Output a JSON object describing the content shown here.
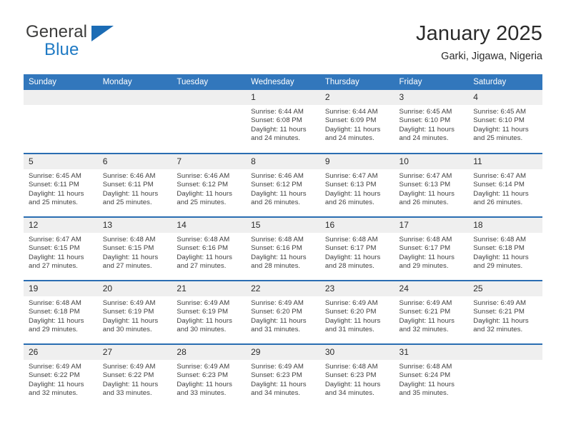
{
  "brand": {
    "name_top": "General",
    "name_bottom": "Blue",
    "color_dark": "#3c3c3b",
    "color_blue": "#1f7ac4"
  },
  "header": {
    "title": "January 2025",
    "subtitle": "Garki, Jigawa, Nigeria"
  },
  "theme": {
    "header_blue": "#3277bc",
    "row_divider_blue": "#2a6db2",
    "daynum_gray": "#efefef"
  },
  "weekday_headers": [
    "Sunday",
    "Monday",
    "Tuesday",
    "Wednesday",
    "Thursday",
    "Friday",
    "Saturday"
  ],
  "weeks": [
    [
      {
        "day": "",
        "lines": []
      },
      {
        "day": "",
        "lines": []
      },
      {
        "day": "",
        "lines": []
      },
      {
        "day": "1",
        "lines": [
          "Sunrise: 6:44 AM",
          "Sunset: 6:08 PM",
          "Daylight: 11 hours",
          "and 24 minutes."
        ]
      },
      {
        "day": "2",
        "lines": [
          "Sunrise: 6:44 AM",
          "Sunset: 6:09 PM",
          "Daylight: 11 hours",
          "and 24 minutes."
        ]
      },
      {
        "day": "3",
        "lines": [
          "Sunrise: 6:45 AM",
          "Sunset: 6:10 PM",
          "Daylight: 11 hours",
          "and 24 minutes."
        ]
      },
      {
        "day": "4",
        "lines": [
          "Sunrise: 6:45 AM",
          "Sunset: 6:10 PM",
          "Daylight: 11 hours",
          "and 25 minutes."
        ]
      }
    ],
    [
      {
        "day": "5",
        "lines": [
          "Sunrise: 6:45 AM",
          "Sunset: 6:11 PM",
          "Daylight: 11 hours",
          "and 25 minutes."
        ]
      },
      {
        "day": "6",
        "lines": [
          "Sunrise: 6:46 AM",
          "Sunset: 6:11 PM",
          "Daylight: 11 hours",
          "and 25 minutes."
        ]
      },
      {
        "day": "7",
        "lines": [
          "Sunrise: 6:46 AM",
          "Sunset: 6:12 PM",
          "Daylight: 11 hours",
          "and 25 minutes."
        ]
      },
      {
        "day": "8",
        "lines": [
          "Sunrise: 6:46 AM",
          "Sunset: 6:12 PM",
          "Daylight: 11 hours",
          "and 26 minutes."
        ]
      },
      {
        "day": "9",
        "lines": [
          "Sunrise: 6:47 AM",
          "Sunset: 6:13 PM",
          "Daylight: 11 hours",
          "and 26 minutes."
        ]
      },
      {
        "day": "10",
        "lines": [
          "Sunrise: 6:47 AM",
          "Sunset: 6:13 PM",
          "Daylight: 11 hours",
          "and 26 minutes."
        ]
      },
      {
        "day": "11",
        "lines": [
          "Sunrise: 6:47 AM",
          "Sunset: 6:14 PM",
          "Daylight: 11 hours",
          "and 26 minutes."
        ]
      }
    ],
    [
      {
        "day": "12",
        "lines": [
          "Sunrise: 6:47 AM",
          "Sunset: 6:15 PM",
          "Daylight: 11 hours",
          "and 27 minutes."
        ]
      },
      {
        "day": "13",
        "lines": [
          "Sunrise: 6:48 AM",
          "Sunset: 6:15 PM",
          "Daylight: 11 hours",
          "and 27 minutes."
        ]
      },
      {
        "day": "14",
        "lines": [
          "Sunrise: 6:48 AM",
          "Sunset: 6:16 PM",
          "Daylight: 11 hours",
          "and 27 minutes."
        ]
      },
      {
        "day": "15",
        "lines": [
          "Sunrise: 6:48 AM",
          "Sunset: 6:16 PM",
          "Daylight: 11 hours",
          "and 28 minutes."
        ]
      },
      {
        "day": "16",
        "lines": [
          "Sunrise: 6:48 AM",
          "Sunset: 6:17 PM",
          "Daylight: 11 hours",
          "and 28 minutes."
        ]
      },
      {
        "day": "17",
        "lines": [
          "Sunrise: 6:48 AM",
          "Sunset: 6:17 PM",
          "Daylight: 11 hours",
          "and 29 minutes."
        ]
      },
      {
        "day": "18",
        "lines": [
          "Sunrise: 6:48 AM",
          "Sunset: 6:18 PM",
          "Daylight: 11 hours",
          "and 29 minutes."
        ]
      }
    ],
    [
      {
        "day": "19",
        "lines": [
          "Sunrise: 6:48 AM",
          "Sunset: 6:18 PM",
          "Daylight: 11 hours",
          "and 29 minutes."
        ]
      },
      {
        "day": "20",
        "lines": [
          "Sunrise: 6:49 AM",
          "Sunset: 6:19 PM",
          "Daylight: 11 hours",
          "and 30 minutes."
        ]
      },
      {
        "day": "21",
        "lines": [
          "Sunrise: 6:49 AM",
          "Sunset: 6:19 PM",
          "Daylight: 11 hours",
          "and 30 minutes."
        ]
      },
      {
        "day": "22",
        "lines": [
          "Sunrise: 6:49 AM",
          "Sunset: 6:20 PM",
          "Daylight: 11 hours",
          "and 31 minutes."
        ]
      },
      {
        "day": "23",
        "lines": [
          "Sunrise: 6:49 AM",
          "Sunset: 6:20 PM",
          "Daylight: 11 hours",
          "and 31 minutes."
        ]
      },
      {
        "day": "24",
        "lines": [
          "Sunrise: 6:49 AM",
          "Sunset: 6:21 PM",
          "Daylight: 11 hours",
          "and 32 minutes."
        ]
      },
      {
        "day": "25",
        "lines": [
          "Sunrise: 6:49 AM",
          "Sunset: 6:21 PM",
          "Daylight: 11 hours",
          "and 32 minutes."
        ]
      }
    ],
    [
      {
        "day": "26",
        "lines": [
          "Sunrise: 6:49 AM",
          "Sunset: 6:22 PM",
          "Daylight: 11 hours",
          "and 32 minutes."
        ]
      },
      {
        "day": "27",
        "lines": [
          "Sunrise: 6:49 AM",
          "Sunset: 6:22 PM",
          "Daylight: 11 hours",
          "and 33 minutes."
        ]
      },
      {
        "day": "28",
        "lines": [
          "Sunrise: 6:49 AM",
          "Sunset: 6:23 PM",
          "Daylight: 11 hours",
          "and 33 minutes."
        ]
      },
      {
        "day": "29",
        "lines": [
          "Sunrise: 6:49 AM",
          "Sunset: 6:23 PM",
          "Daylight: 11 hours",
          "and 34 minutes."
        ]
      },
      {
        "day": "30",
        "lines": [
          "Sunrise: 6:48 AM",
          "Sunset: 6:23 PM",
          "Daylight: 11 hours",
          "and 34 minutes."
        ]
      },
      {
        "day": "31",
        "lines": [
          "Sunrise: 6:48 AM",
          "Sunset: 6:24 PM",
          "Daylight: 11 hours",
          "and 35 minutes."
        ]
      },
      {
        "day": "",
        "lines": []
      }
    ]
  ]
}
